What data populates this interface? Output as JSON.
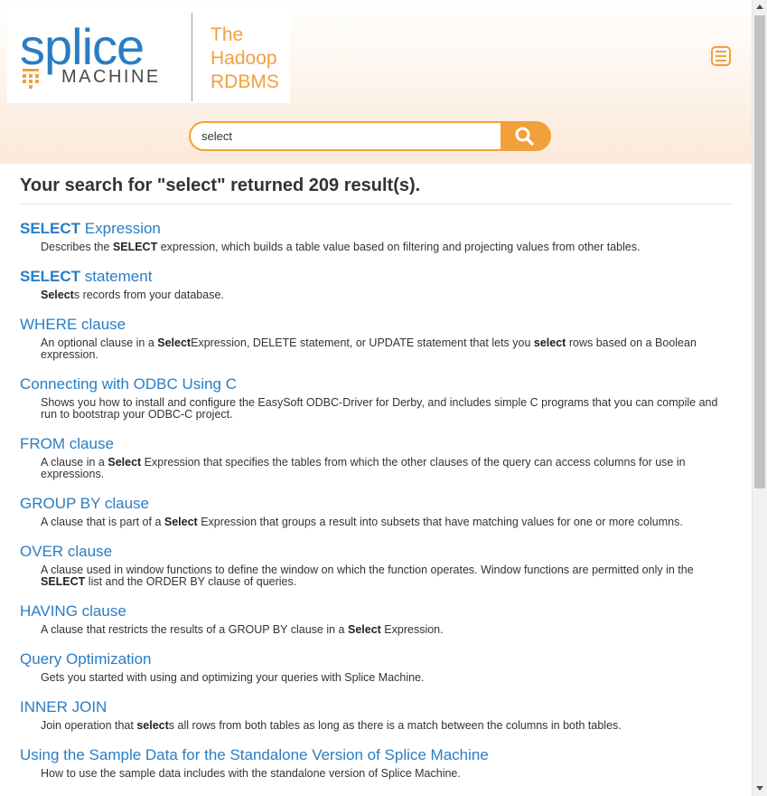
{
  "header": {
    "logo": {
      "word": "splice",
      "subword": "MACHINE"
    },
    "tagline": [
      "The",
      "Hadoop",
      "RDBMS"
    ],
    "menu_icon": "hamburger-menu-icon"
  },
  "search": {
    "value": "select",
    "button_icon": "search-icon"
  },
  "results_heading": "Your search for \"select\" returned 209 result(s).",
  "results": [
    {
      "title_bold": "SELECT",
      "title_rest": " Expression",
      "desc": [
        [
          "Describes the ",
          false
        ],
        [
          "SELECT",
          true
        ],
        [
          " expression, which builds a table value based on filtering and projecting values from other tables.",
          false
        ]
      ]
    },
    {
      "title_bold": "SELECT",
      "title_rest": " statement",
      "desc": [
        [
          "Select",
          true
        ],
        [
          "s records from your database.",
          false
        ]
      ]
    },
    {
      "title_bold": "",
      "title_rest": "WHERE clause",
      "desc": [
        [
          "An optional clause in a ",
          false
        ],
        [
          "Select",
          true
        ],
        [
          "Expression, DELETE statement, or UPDATE statement that lets you ",
          false
        ],
        [
          "select",
          true
        ],
        [
          " rows based on a Boolean expression.",
          false
        ]
      ]
    },
    {
      "title_bold": "",
      "title_rest": "Connecting with ODBC Using C",
      "desc": [
        [
          "Shows you how to install and configure the EasySoft ODBC-Driver for Derby, and includes simple C programs that you can compile and run to bootstrap your ODBC-C project.",
          false
        ]
      ]
    },
    {
      "title_bold": "",
      "title_rest": "FROM clause",
      "desc": [
        [
          "A clause in a ",
          false
        ],
        [
          "Select",
          true
        ],
        [
          " Expression that specifies the tables from which the other clauses of the query can access columns for use in expressions.",
          false
        ]
      ]
    },
    {
      "title_bold": "",
      "title_rest": "GROUP BY clause",
      "desc": [
        [
          "A clause that is part of a ",
          false
        ],
        [
          "Select",
          true
        ],
        [
          " Expression that groups a result into subsets that have matching values for one or more columns.",
          false
        ]
      ]
    },
    {
      "title_bold": "",
      "title_rest": "OVER clause",
      "desc": [
        [
          "A clause used in window functions to define the window on which the function operates. Window functions are permitted only in the ",
          false
        ],
        [
          "SELECT",
          true
        ],
        [
          " list and the ORDER BY clause of queries.",
          false
        ]
      ]
    },
    {
      "title_bold": "",
      "title_rest": "HAVING clause",
      "desc": [
        [
          "A clause that restricts the results of a GROUP BY clause in a ",
          false
        ],
        [
          "Select",
          true
        ],
        [
          " Expression.",
          false
        ]
      ]
    },
    {
      "title_bold": "",
      "title_rest": "Query Optimization",
      "desc": [
        [
          "Gets you started with using and optimizing your queries with Splice Machine.",
          false
        ]
      ]
    },
    {
      "title_bold": "",
      "title_rest": "INNER JOIN",
      "desc": [
        [
          "Join operation that ",
          false
        ],
        [
          "select",
          true
        ],
        [
          "s all rows from both tables as long as there is a match between the columns in both tables.",
          false
        ]
      ]
    },
    {
      "title_bold": "",
      "title_rest": "Using the Sample Data for the Standalone Version of Splice Machine",
      "desc": [
        [
          "How to use the sample data includes with the standalone version of Splice Machine.",
          false
        ]
      ]
    }
  ],
  "colors": {
    "brand_blue": "#2a7dc3",
    "accent_orange": "#f2a03a"
  }
}
